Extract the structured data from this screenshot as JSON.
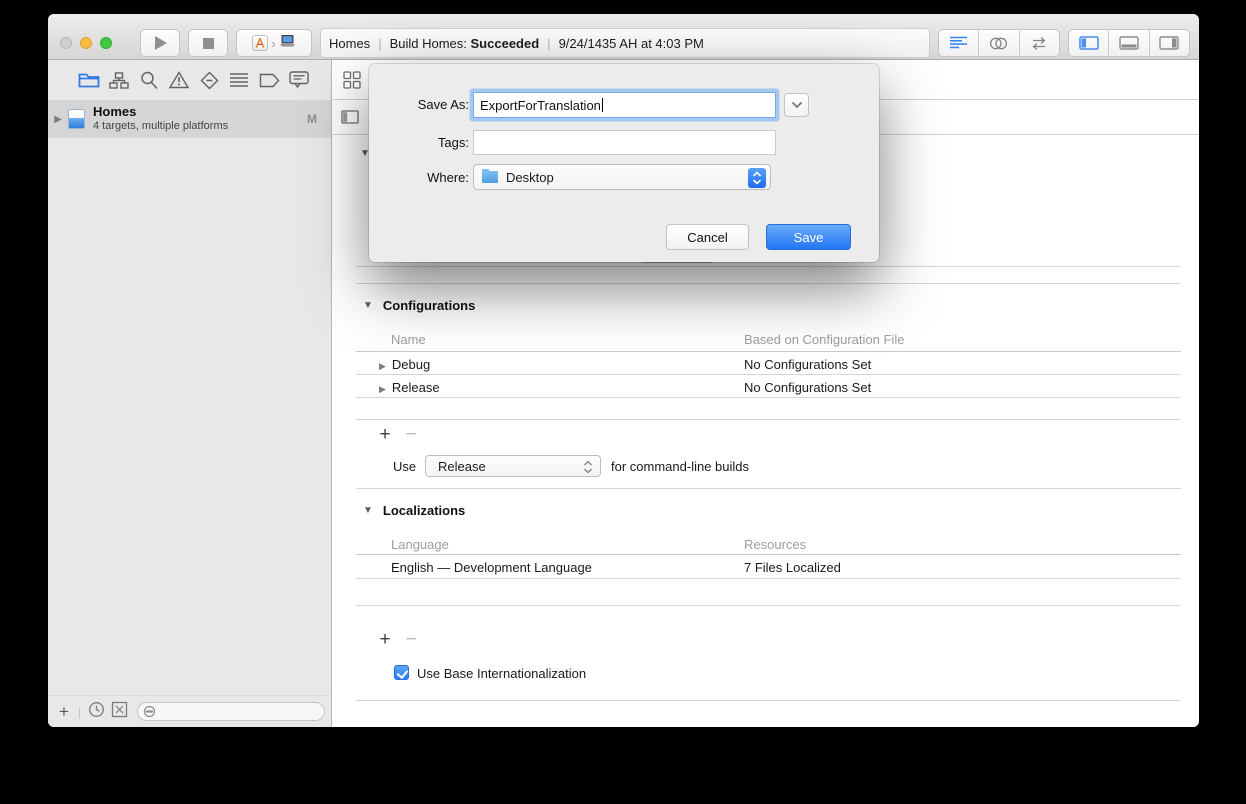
{
  "icons": {
    "disclosure_down": "▼",
    "disclosure_right": "▶",
    "plus": "+",
    "minus": "−",
    "scheme_chevron": "›",
    "filter_divider": "|"
  },
  "toolbar": {
    "status_project": "Homes",
    "status_sep1": "|",
    "status_build_label": "Build Homes:",
    "status_build_result": "Succeeded",
    "status_sep2": "|",
    "status_time": "9/24/1435 AH at 4:03 PM"
  },
  "sidebar": {
    "project_name": "Homes",
    "project_subtitle": "4 targets, multiple platforms",
    "project_badge": "M"
  },
  "editor": {
    "configurations": {
      "title": "Configurations",
      "col_name": "Name",
      "col_file": "Based on Configuration File",
      "rows": [
        {
          "name": "Debug",
          "value": "No Configurations Set"
        },
        {
          "name": "Release",
          "value": "No Configurations Set"
        }
      ],
      "use_prefix": "Use",
      "use_value": "Release",
      "use_suffix": "for command-line builds"
    },
    "localizations": {
      "title": "Localizations",
      "col_language": "Language",
      "col_resources": "Resources",
      "rows": [
        {
          "language": "English — Development Language",
          "resources": "7 Files Localized"
        }
      ],
      "base_intl_label": "Use Base Internationalization"
    }
  },
  "save_dialog": {
    "save_as_label": "Save As:",
    "save_as_value": "ExportForTranslation",
    "tags_label": "Tags:",
    "tags_value": "",
    "where_label": "Where:",
    "where_value": "Desktop",
    "cancel_label": "Cancel",
    "save_label": "Save"
  },
  "colors": {
    "accent_blue": "#2d7ff5",
    "save_button_blue": "#338ef7",
    "focus_ring": "#7fb5f0",
    "active_icon_blue": "#3b87f0"
  }
}
